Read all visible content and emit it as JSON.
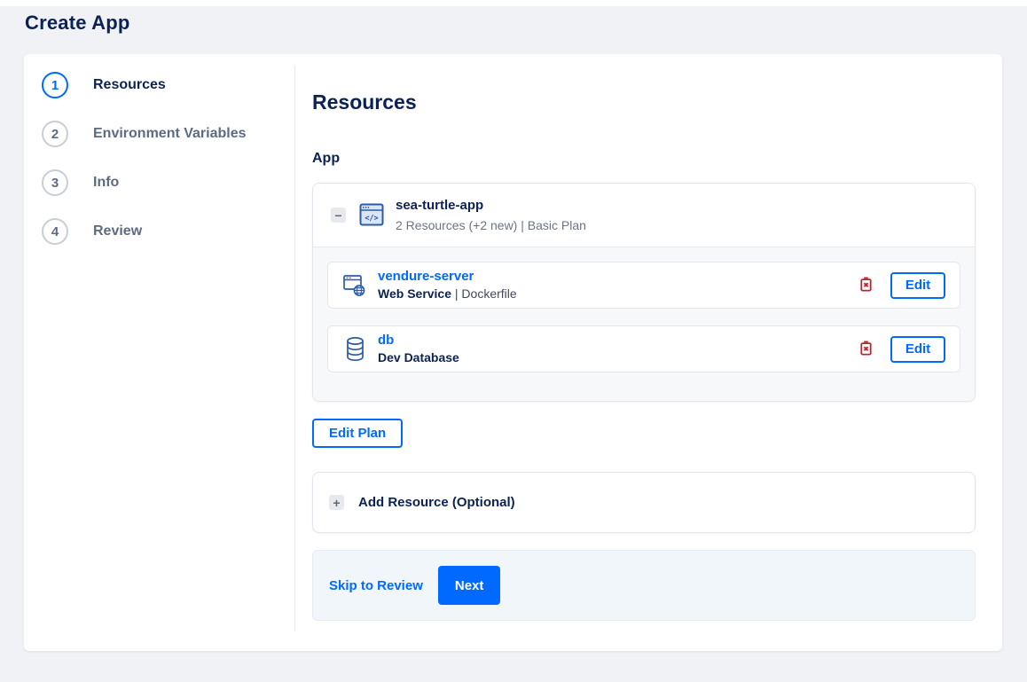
{
  "page": {
    "title": "Create App"
  },
  "stepper": {
    "steps": [
      {
        "number": "1",
        "label": "Resources",
        "active": true
      },
      {
        "number": "2",
        "label": "Environment Variables",
        "active": false
      },
      {
        "number": "3",
        "label": "Info",
        "active": false
      },
      {
        "number": "4",
        "label": "Review",
        "active": false
      }
    ]
  },
  "content": {
    "heading": "Resources",
    "section_label": "App",
    "app_group": {
      "collapse_glyph": "−",
      "icon": "app-window-code-icon",
      "name": "sea-turtle-app",
      "summary": "2 Resources (+2 new) | Basic Plan",
      "resources": [
        {
          "icon": "web-service-icon",
          "name": "vendure-server",
          "type": "Web Service",
          "detail": " | Dockerfile",
          "delete_icon": "trash-icon",
          "edit_label": "Edit"
        },
        {
          "icon": "database-icon",
          "name": "db",
          "type": "Dev Database",
          "detail": "",
          "delete_icon": "trash-icon",
          "edit_label": "Edit"
        }
      ]
    },
    "edit_plan_label": "Edit Plan",
    "add_resource_glyph": "+",
    "add_resource_label": "Add Resource (Optional)",
    "footer": {
      "skip_label": "Skip to Review",
      "next_label": "Next"
    }
  },
  "colors": {
    "accent": "#0069ff",
    "navy": "#0b2253",
    "danger": "#c2242e",
    "page_background": "#f0f2f5",
    "footer_background": "#f1f6fb"
  }
}
